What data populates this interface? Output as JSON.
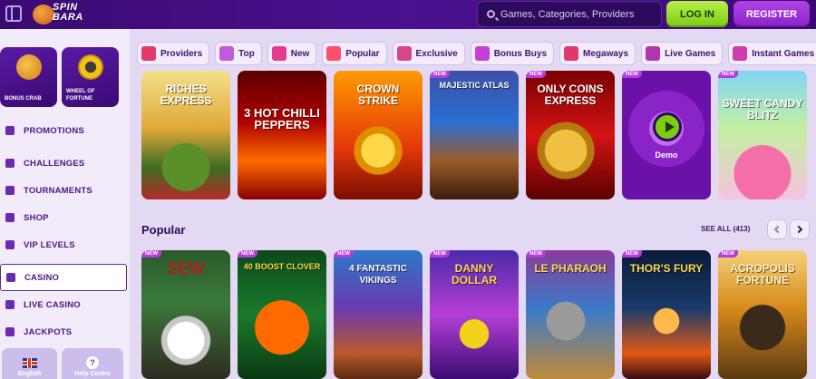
{
  "header": {
    "logo_line1": "SPIN",
    "logo_line2": "BARA",
    "search_placeholder": "Games, Categories, Providers",
    "login_label": "LOG IN",
    "register_label": "REGISTER"
  },
  "sidebar": {
    "promos": [
      {
        "label": "BONUS CRAB"
      },
      {
        "label": "WHEEL OF FORTUNE"
      }
    ],
    "items": [
      {
        "label": "PROMOTIONS",
        "icon": "gift-icon"
      },
      {
        "label": "CHALLENGES",
        "icon": "flag-icon"
      },
      {
        "label": "TOURNAMENTS",
        "icon": "trophy-icon"
      },
      {
        "label": "SHOP",
        "icon": "shop-icon"
      },
      {
        "label": "VIP LEVELS",
        "icon": "crown-icon"
      },
      {
        "label": "CASINO",
        "icon": "slot-icon"
      },
      {
        "label": "LIVE CASINO",
        "icon": "cards-icon"
      },
      {
        "label": "JACKPOTS",
        "icon": "jackpot-icon"
      }
    ],
    "language": "English",
    "help": "Help Centre"
  },
  "categories": [
    {
      "label": "Providers",
      "icon": "book-icon",
      "color": "#e23b6a"
    },
    {
      "label": "Top",
      "icon": "crown-icon",
      "color": "#c15bd9"
    },
    {
      "label": "New",
      "icon": "lightning-icon",
      "color": "#e63a8e"
    },
    {
      "label": "Popular",
      "icon": "fire-icon",
      "color": "#ff4d6d"
    },
    {
      "label": "Exclusive",
      "icon": "diamond-icon",
      "color": "#d9448e"
    },
    {
      "label": "Bonus Buys",
      "icon": "gift-icon",
      "color": "#c83dd6"
    },
    {
      "label": "Megaways",
      "icon": "m-icon",
      "color": "#e2376a"
    },
    {
      "label": "Live Games",
      "icon": "chip-icon",
      "color": "#b036b0"
    },
    {
      "label": "Instant Games",
      "icon": "gamepad-icon",
      "color": "#d03db0"
    }
  ],
  "row1": [
    {
      "title": "Riches Express",
      "new": false
    },
    {
      "title": "3 Hot Chilli Peppers",
      "new": false
    },
    {
      "title": "Crown Strike",
      "new": false
    },
    {
      "title": "Majestic Atlas",
      "new": true
    },
    {
      "title": "Only Coins Express",
      "new": true
    },
    {
      "title": "",
      "new": true,
      "demo": "Demo"
    },
    {
      "title": "Sweet Candy Blitz",
      "new": true
    }
  ],
  "popular": {
    "title": "Popular",
    "see_all": "SEE ALL (413)",
    "games": [
      {
        "title": "SEW",
        "new": true
      },
      {
        "title": "40 Boost Clover",
        "new": true
      },
      {
        "title": "4 Fantastic Vikings",
        "new": true
      },
      {
        "title": "Danny Dollar",
        "new": true
      },
      {
        "title": "Le Pharaoh",
        "new": true
      },
      {
        "title": "Thor's Fury",
        "new": true
      },
      {
        "title": "Acropolis Fortune",
        "new": true
      }
    ]
  },
  "new_badge": "NEW"
}
